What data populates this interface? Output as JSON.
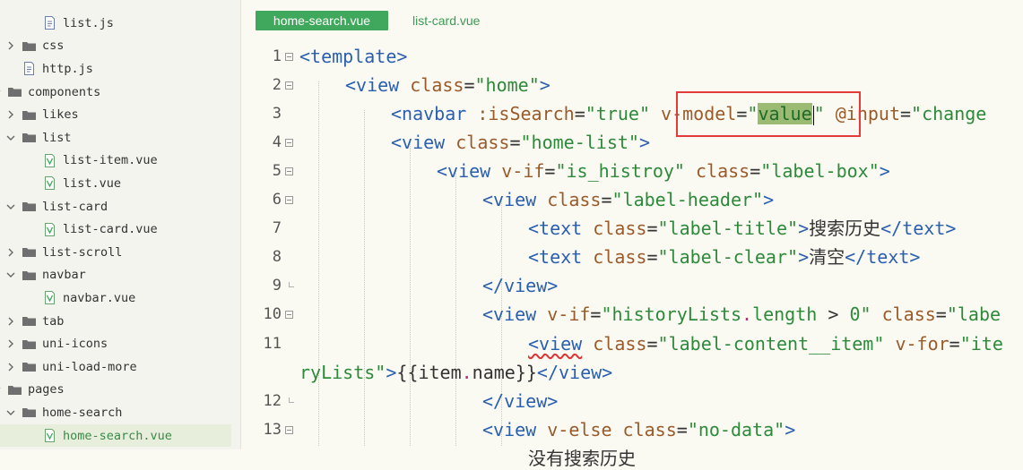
{
  "sidebar": {
    "items": [
      {
        "label": "list.js",
        "kind": "file",
        "depth": 2,
        "expanded": null,
        "selected": false
      },
      {
        "label": "css",
        "kind": "folder",
        "depth": 0,
        "expanded": false,
        "selected": false
      },
      {
        "label": "http.js",
        "kind": "file",
        "depth": 1,
        "expanded": null,
        "selected": false
      },
      {
        "label": "components",
        "kind": "folder",
        "depth": -1,
        "expanded": true,
        "selected": false
      },
      {
        "label": "likes",
        "kind": "folder",
        "depth": 0,
        "expanded": false,
        "selected": false
      },
      {
        "label": "list",
        "kind": "folder",
        "depth": 0,
        "expanded": true,
        "selected": false
      },
      {
        "label": "list-item.vue",
        "kind": "vue",
        "depth": 2,
        "expanded": null,
        "selected": false
      },
      {
        "label": "list.vue",
        "kind": "vue",
        "depth": 2,
        "expanded": null,
        "selected": false
      },
      {
        "label": "list-card",
        "kind": "folder",
        "depth": 0,
        "expanded": true,
        "selected": false
      },
      {
        "label": "list-card.vue",
        "kind": "vue",
        "depth": 2,
        "expanded": null,
        "selected": false
      },
      {
        "label": "list-scroll",
        "kind": "folder",
        "depth": 0,
        "expanded": false,
        "selected": false
      },
      {
        "label": "navbar",
        "kind": "folder",
        "depth": 0,
        "expanded": true,
        "selected": false
      },
      {
        "label": "navbar.vue",
        "kind": "vue",
        "depth": 2,
        "expanded": null,
        "selected": false
      },
      {
        "label": "tab",
        "kind": "folder",
        "depth": 0,
        "expanded": false,
        "selected": false
      },
      {
        "label": "uni-icons",
        "kind": "folder",
        "depth": 0,
        "expanded": false,
        "selected": false
      },
      {
        "label": "uni-load-more",
        "kind": "folder",
        "depth": 0,
        "expanded": false,
        "selected": false
      },
      {
        "label": "pages",
        "kind": "folder",
        "depth": -1,
        "expanded": true,
        "selected": false
      },
      {
        "label": "home-search",
        "kind": "folder",
        "depth": 0,
        "expanded": true,
        "selected": false
      },
      {
        "label": "home-search.vue",
        "kind": "vue",
        "depth": 2,
        "expanded": null,
        "selected": true
      }
    ]
  },
  "tabs": {
    "active": "home-search.vue",
    "inactive": "list-card.vue"
  },
  "editor": {
    "lines": [
      {
        "num": "1",
        "fold": "open",
        "tokens": [
          [
            "t",
            "<template>"
          ]
        ]
      },
      {
        "num": "2",
        "fold": "open",
        "tokens": [
          [
            "t",
            "<view "
          ],
          [
            "a",
            "class"
          ],
          [
            "p",
            "="
          ],
          [
            "s",
            "\"home\""
          ],
          [
            "t",
            ">"
          ]
        ]
      },
      {
        "num": "3",
        "fold": "none",
        "tokens": [
          [
            "t",
            "<navbar "
          ],
          [
            "a",
            ":isSearch"
          ],
          [
            "p",
            "="
          ],
          [
            "s",
            "\"true\""
          ],
          [
            "p",
            " "
          ],
          [
            "a",
            "v-model"
          ],
          [
            "p",
            "="
          ],
          [
            "s",
            "\""
          ],
          [
            "hl",
            "value"
          ],
          [
            "cursor",
            ""
          ],
          [
            "s",
            "\""
          ],
          [
            "p",
            " "
          ],
          [
            "a",
            "@input"
          ],
          [
            "p",
            "="
          ],
          [
            "s",
            "\"change"
          ]
        ]
      },
      {
        "num": "4",
        "fold": "open",
        "tokens": [
          [
            "t",
            "<view "
          ],
          [
            "a",
            "class"
          ],
          [
            "p",
            "="
          ],
          [
            "s",
            "\"home-list\""
          ],
          [
            "t",
            ">"
          ]
        ]
      },
      {
        "num": "5",
        "fold": "open",
        "tokens": [
          [
            "t",
            "<view "
          ],
          [
            "a",
            "v-if"
          ],
          [
            "p",
            "="
          ],
          [
            "s",
            "\"is_histroy\""
          ],
          [
            "p",
            " "
          ],
          [
            "a",
            "class"
          ],
          [
            "p",
            "="
          ],
          [
            "s",
            "\"label-box\""
          ],
          [
            "t",
            ">"
          ]
        ]
      },
      {
        "num": "6",
        "fold": "open",
        "tokens": [
          [
            "t",
            "<view "
          ],
          [
            "a",
            "class"
          ],
          [
            "p",
            "="
          ],
          [
            "s",
            "\"label-header\""
          ],
          [
            "t",
            ">"
          ]
        ]
      },
      {
        "num": "7",
        "fold": "none",
        "tokens": [
          [
            "t",
            "<text "
          ],
          [
            "a",
            "class"
          ],
          [
            "p",
            "="
          ],
          [
            "s",
            "\"label-title\""
          ],
          [
            "t",
            ">"
          ],
          [
            "p",
            "搜索历史"
          ],
          [
            "t",
            "</text>"
          ]
        ]
      },
      {
        "num": "8",
        "fold": "none",
        "tokens": [
          [
            "t",
            "<text "
          ],
          [
            "a",
            "class"
          ],
          [
            "p",
            "="
          ],
          [
            "s",
            "\"label-clear\""
          ],
          [
            "t",
            ">"
          ],
          [
            "p",
            "清空"
          ],
          [
            "t",
            "</text>"
          ]
        ]
      },
      {
        "num": "9",
        "fold": "end",
        "tokens": [
          [
            "t",
            "</view>"
          ]
        ]
      },
      {
        "num": "10",
        "fold": "open",
        "tokens": [
          [
            "t",
            "<view "
          ],
          [
            "a",
            "v-if"
          ],
          [
            "p",
            "="
          ],
          [
            "s",
            "\"historyLists"
          ],
          [
            "d",
            "."
          ],
          [
            "s",
            "length "
          ],
          [
            "o",
            ">"
          ],
          [
            "s",
            " 0\""
          ],
          [
            "p",
            " "
          ],
          [
            "a",
            "class"
          ],
          [
            "p",
            "="
          ],
          [
            "s",
            "\"labe"
          ]
        ]
      },
      {
        "num": "11",
        "fold": "none",
        "tokens": [
          [
            "sqt",
            "<view"
          ],
          [
            "p",
            " "
          ],
          [
            "a",
            "class"
          ],
          [
            "p",
            "="
          ],
          [
            "s",
            "\"label-content__item\""
          ],
          [
            "p",
            " "
          ],
          [
            "a",
            "v-for"
          ],
          [
            "p",
            "="
          ],
          [
            "s",
            "\"ite"
          ]
        ]
      },
      {
        "num": "",
        "fold": "none",
        "tokens": [
          [
            "s",
            "ryLists\""
          ],
          [
            "t",
            ">"
          ],
          [
            "p",
            "{{item"
          ],
          [
            "d",
            "."
          ],
          [
            "p",
            "name}}"
          ],
          [
            "t",
            "</view>"
          ]
        ]
      },
      {
        "num": "12",
        "fold": "end",
        "tokens": [
          [
            "t",
            "</view>"
          ]
        ]
      },
      {
        "num": "13",
        "fold": "open",
        "tokens": [
          [
            "t",
            "<view "
          ],
          [
            "a",
            "v-else"
          ],
          [
            "p",
            " "
          ],
          [
            "a",
            "class"
          ],
          [
            "p",
            "="
          ],
          [
            "s",
            "\"no-data\""
          ],
          [
            "t",
            ">"
          ]
        ]
      },
      {
        "num": "",
        "fold": "none",
        "tokens": [
          [
            "p",
            "没有搜索历史"
          ]
        ]
      }
    ]
  },
  "colors": {
    "tab_active_bg": "#3fa85c",
    "tab_inactive_text": "#3c9a54",
    "tag": "#2a5fb0",
    "attr": "#9a5a2a",
    "string": "#2d8a3a",
    "highlight": "#9bbb72",
    "annotation_box": "#e33a3a"
  },
  "icons": {
    "folder": "folder-icon",
    "file": "js-file-icon",
    "vue": "vue-file-icon",
    "chevron_right": "chevron-right-icon",
    "chevron_down": "chevron-down-icon"
  }
}
